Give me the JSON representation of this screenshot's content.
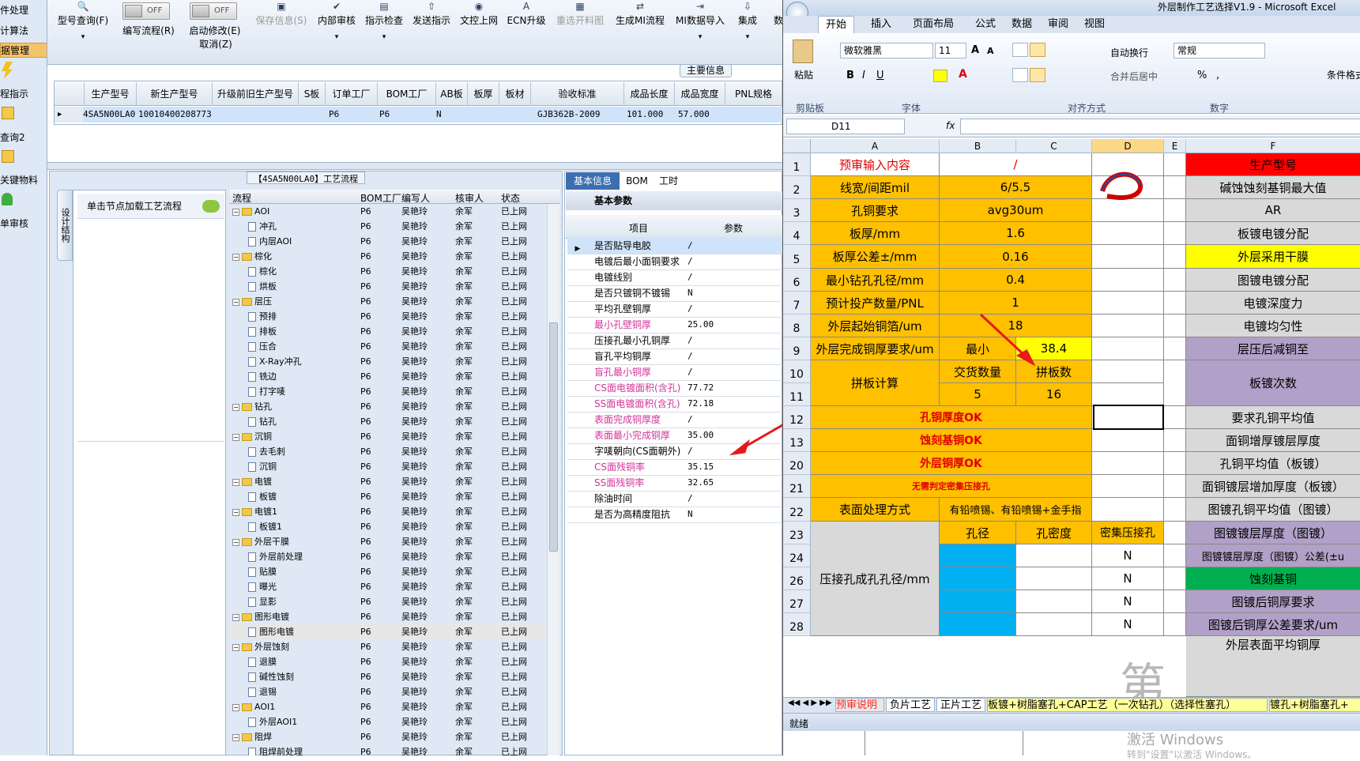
{
  "left_strip": {
    "items": [
      "件处理",
      "计算法",
      "据管理",
      "程指示",
      "查询2",
      "关键物料",
      "单审核"
    ]
  },
  "toolbar": {
    "buttons": [
      {
        "label": "型号查询(F)",
        "icon": "search-icon"
      },
      {
        "label": "编写流程(R)",
        "icon": "toggle-icon"
      },
      {
        "label": "启动修改(E)",
        "icon": "toggle-icon"
      },
      {
        "label": "取消(Z)",
        "icon": ""
      },
      {
        "label": "保存信息(S)",
        "icon": "save-icon"
      },
      {
        "label": "内部审核",
        "icon": "check-icon"
      },
      {
        "label": "指示检查",
        "icon": "clipboard-icon"
      },
      {
        "label": "发送指示",
        "icon": "upload-icon"
      },
      {
        "label": "文控上网",
        "icon": "globe-icon"
      },
      {
        "label": "ECN升级",
        "icon": "ecn-icon"
      },
      {
        "label": "重选开料图",
        "icon": "image-icon"
      },
      {
        "label": "生成MI流程",
        "icon": "flow-icon"
      },
      {
        "label": "MI数据导入",
        "icon": "import-icon"
      },
      {
        "label": "集成",
        "icon": "integrate-icon"
      },
      {
        "label": "数",
        "icon": ""
      }
    ],
    "toggle_off": "OFF"
  },
  "main_info_label": "主要信息",
  "grid": {
    "headers": [
      "生产型号",
      "新生产型号",
      "升级前旧生产型号",
      "S板",
      "订单工厂",
      "BOM工厂",
      "AB板",
      "板厚",
      "板材",
      "验收标准",
      "成品长度",
      "成品宽度",
      "PNL规格"
    ],
    "row": [
      "4SA5N00LA0",
      "10010400208773",
      "",
      "",
      "P6",
      "P6",
      "N",
      "",
      "",
      "GJB362B-2009",
      "101.000",
      "57.000",
      ""
    ]
  },
  "process_title": "【4SA5N00LA0】工艺流程",
  "side_tab": "设计结构",
  "load_hint": "单击节点加载工艺流程",
  "tree": {
    "headers": [
      "流程",
      "BOM工厂",
      "编写人",
      "核审人",
      "状态"
    ],
    "author": "吴艳玲",
    "reviewer": "余军",
    "factory": "P6",
    "status": "已上网",
    "rows": [
      {
        "t": "f",
        "n": "AOI"
      },
      {
        "t": "d",
        "n": "冲孔"
      },
      {
        "t": "d",
        "n": "内层AOI"
      },
      {
        "t": "f",
        "n": "棕化"
      },
      {
        "t": "d",
        "n": "棕化"
      },
      {
        "t": "d",
        "n": "烘板"
      },
      {
        "t": "f",
        "n": "层压"
      },
      {
        "t": "d",
        "n": "预排"
      },
      {
        "t": "d",
        "n": "排板"
      },
      {
        "t": "d",
        "n": "压合"
      },
      {
        "t": "d",
        "n": "X-Ray冲孔"
      },
      {
        "t": "d",
        "n": "铣边"
      },
      {
        "t": "d",
        "n": "打字唛"
      },
      {
        "t": "f",
        "n": "钻孔"
      },
      {
        "t": "d",
        "n": "钻孔"
      },
      {
        "t": "f",
        "n": "沉铜"
      },
      {
        "t": "d",
        "n": "去毛刺"
      },
      {
        "t": "d",
        "n": "沉铜"
      },
      {
        "t": "f",
        "n": "电镀"
      },
      {
        "t": "d",
        "n": "板镀"
      },
      {
        "t": "f",
        "n": "电镀1"
      },
      {
        "t": "d",
        "n": "板镀1"
      },
      {
        "t": "f",
        "n": "外层干膜"
      },
      {
        "t": "d",
        "n": "外层前处理"
      },
      {
        "t": "d",
        "n": "贴膜"
      },
      {
        "t": "d",
        "n": "曝光"
      },
      {
        "t": "d",
        "n": "显影"
      },
      {
        "t": "f",
        "n": "图形电镀"
      },
      {
        "t": "d",
        "n": "图形电镀"
      },
      {
        "t": "f",
        "n": "外层蚀刻"
      },
      {
        "t": "d",
        "n": "退膜"
      },
      {
        "t": "d",
        "n": "碱性蚀刻"
      },
      {
        "t": "d",
        "n": "退锡"
      },
      {
        "t": "f",
        "n": "AOI1"
      },
      {
        "t": "d",
        "n": "外层AOI1"
      },
      {
        "t": "f",
        "n": "阻焊"
      },
      {
        "t": "d",
        "n": "阻焊前处理"
      }
    ]
  },
  "tabs": [
    "基本信息",
    "BOM",
    "工时"
  ],
  "params": {
    "title": "基本参数",
    "headers": [
      "项目",
      "参数"
    ],
    "rows": [
      {
        "k": "是否贴导电胶",
        "v": "/",
        "pink": false
      },
      {
        "k": "电镀后最小面铜要求",
        "v": "/",
        "pink": false
      },
      {
        "k": "电镀线别",
        "v": "/",
        "pink": false
      },
      {
        "k": "是否只镀铜不镀锡",
        "v": "N",
        "pink": false
      },
      {
        "k": "平均孔壁铜厚",
        "v": "/",
        "pink": false
      },
      {
        "k": "最小孔壁铜厚",
        "v": "25.00",
        "pink": true
      },
      {
        "k": "压接孔最小孔铜厚",
        "v": "/",
        "pink": false
      },
      {
        "k": "盲孔平均铜厚",
        "v": "/",
        "pink": false
      },
      {
        "k": "盲孔最小铜厚",
        "v": "/",
        "pink": true
      },
      {
        "k": "CS面电镀面积(含孔)",
        "v": "77.72",
        "pink": true
      },
      {
        "k": "SS面电镀面积(含孔)",
        "v": "72.18",
        "pink": true
      },
      {
        "k": "表面完成铜厚度",
        "v": "/",
        "pink": true
      },
      {
        "k": "表面最小完成铜厚",
        "v": "35.00",
        "pink": true
      },
      {
        "k": "字唛朝向(CS面朝外)",
        "v": "/",
        "pink": false
      },
      {
        "k": "CS面残铜率",
        "v": "35.15",
        "pink": true
      },
      {
        "k": "SS面残铜率",
        "v": "32.65",
        "pink": true
      },
      {
        "k": "除油时间",
        "v": "/",
        "pink": false
      },
      {
        "k": "是否为高精度阻抗",
        "v": "N",
        "pink": false
      }
    ]
  },
  "excel": {
    "title": "外层制作工艺选择V1.9 - Microsoft Excel",
    "ribbon_tabs": [
      "开始",
      "插入",
      "页面布局",
      "公式",
      "数据",
      "审阅",
      "视图"
    ],
    "paste": "粘贴",
    "font_name": "微软雅黑",
    "font_size": "11",
    "wrap_text": "自动换行",
    "merge_center": "合并后居中",
    "number_format": "常规",
    "cond_format": "条件格式",
    "groups": [
      "剪贴板",
      "字体",
      "对齐方式",
      "数字"
    ],
    "name_box": "D11",
    "fx": "fx",
    "columns": [
      "A",
      "B",
      "C",
      "D",
      "E",
      "F"
    ],
    "row_numbers": [
      "1",
      "2",
      "3",
      "4",
      "5",
      "6",
      "7",
      "8",
      "9",
      "10",
      "11",
      "12",
      "13",
      "20",
      "21",
      "22",
      "23",
      "24",
      "26",
      "27",
      "28"
    ],
    "cells": {
      "a1": "预审输入内容",
      "b1": "/",
      "f1": "生产型号",
      "a2": "线宽/间距mil",
      "b2": "6/5.5",
      "f2": "碱蚀蚀刻基铜最大值",
      "a3": "孔铜要求",
      "b3": "avg30um",
      "f3": "AR",
      "a4": "板厚/mm",
      "b4": "1.6",
      "f4": "板镀电镀分配",
      "a5": "板厚公差±/mm",
      "b5": "0.16",
      "f5": "外层采用干膜",
      "a6": "最小钻孔孔径/mm",
      "b6": "0.4",
      "f6": "图镀电镀分配",
      "a7": "预计投产数量/PNL",
      "b7": "1",
      "f7": "电镀深度力",
      "a8": "外层起始铜箔/um",
      "b8": "18",
      "f8": "电镀均匀性",
      "a9": "外层完成铜厚要求/um",
      "b9": "最小",
      "c9": "38.4",
      "f9": "层压后减铜至",
      "a10": "拼板计算",
      "b10": "交货数量",
      "c10": "拼板数",
      "f10": "板镀次数",
      "b11": "5",
      "c11": "16",
      "a12": "孔铜厚度OK",
      "f12": "要求孔铜平均值",
      "a13": "蚀刻基铜OK",
      "f13": "面铜增厚镀层厚度",
      "a20": "外层铜厚OK",
      "f20": "孔铜平均值（板镀）",
      "a21": "无需判定密集压接孔",
      "f21": "面铜镀层增加厚度（板镀）",
      "a22": "表面处理方式",
      "b22": "有铅喷锡、有铅喷锡+金手指",
      "f22": "图镀孔铜平均值（图镀）",
      "a23": "压接孔成孔孔径/mm",
      "b23": "孔径",
      "c23": "孔密度",
      "d23": "密集压接孔",
      "f23": "图镀镀层厚度（图镀）",
      "d24": "N",
      "f24": "图镀镀层厚度（图镀）公差(±u",
      "d26": "N",
      "f26": "蚀刻基铜",
      "d27": "N",
      "f27": "图镀后铜厚要求",
      "d28": "N",
      "f28": "图镀后铜厚公差要求/um",
      "f29": "外层表面平均铜厚"
    },
    "sheet_tabs": [
      "预审说明",
      "负片工艺",
      "正片工艺",
      "板镀+树脂塞孔+CAP工艺（一次钻孔）（选择性塞孔）",
      "镀孔+树脂塞孔+"
    ],
    "status": "就绪",
    "watermark_char": "第",
    "activate_line1": "激活 Windows",
    "activate_line2": "转到\"设置\"以激活 Windows。"
  }
}
